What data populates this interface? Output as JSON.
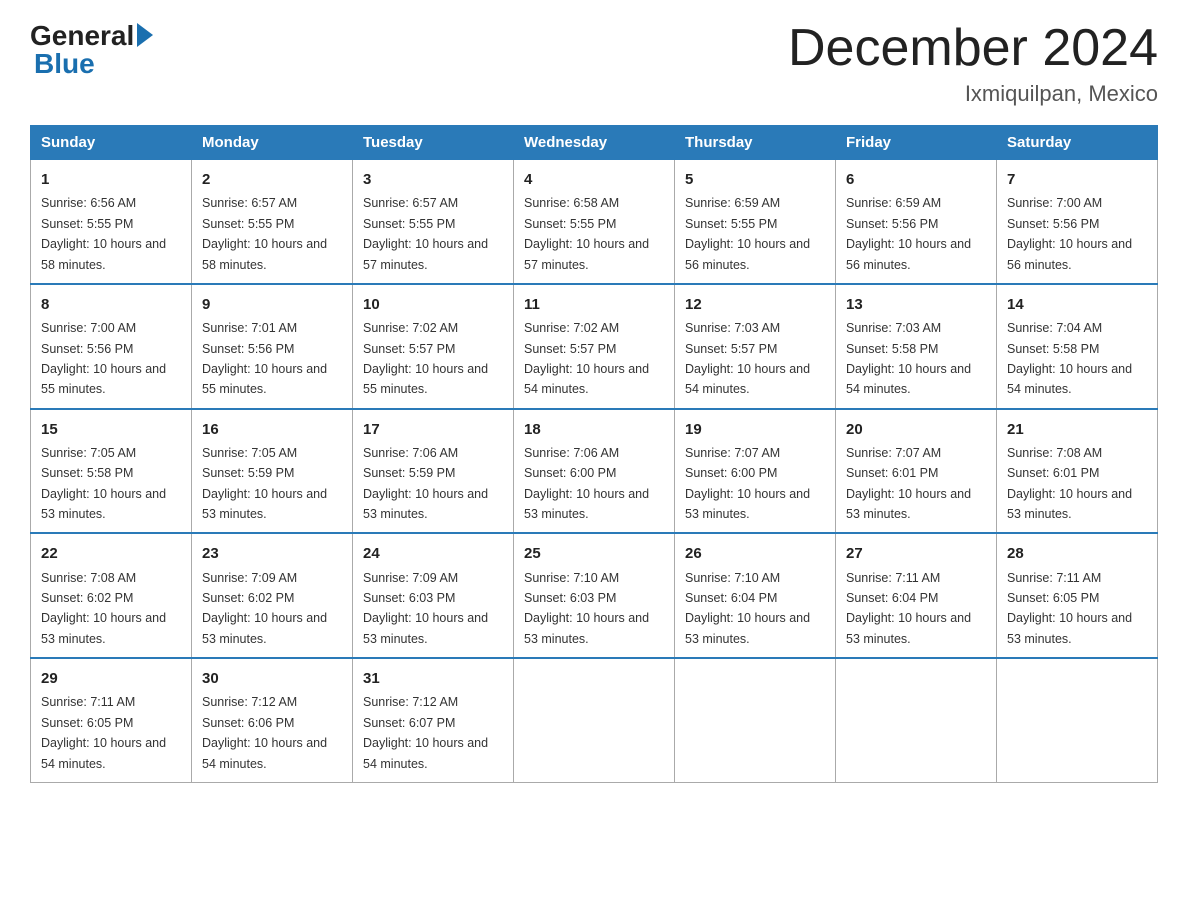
{
  "logo": {
    "general": "General",
    "blue": "Blue"
  },
  "title": "December 2024",
  "location": "Ixmiquilpan, Mexico",
  "headers": [
    "Sunday",
    "Monday",
    "Tuesday",
    "Wednesday",
    "Thursday",
    "Friday",
    "Saturday"
  ],
  "weeks": [
    [
      {
        "day": "1",
        "sunrise": "6:56 AM",
        "sunset": "5:55 PM",
        "daylight": "10 hours and 58 minutes."
      },
      {
        "day": "2",
        "sunrise": "6:57 AM",
        "sunset": "5:55 PM",
        "daylight": "10 hours and 58 minutes."
      },
      {
        "day": "3",
        "sunrise": "6:57 AM",
        "sunset": "5:55 PM",
        "daylight": "10 hours and 57 minutes."
      },
      {
        "day": "4",
        "sunrise": "6:58 AM",
        "sunset": "5:55 PM",
        "daylight": "10 hours and 57 minutes."
      },
      {
        "day": "5",
        "sunrise": "6:59 AM",
        "sunset": "5:55 PM",
        "daylight": "10 hours and 56 minutes."
      },
      {
        "day": "6",
        "sunrise": "6:59 AM",
        "sunset": "5:56 PM",
        "daylight": "10 hours and 56 minutes."
      },
      {
        "day": "7",
        "sunrise": "7:00 AM",
        "sunset": "5:56 PM",
        "daylight": "10 hours and 56 minutes."
      }
    ],
    [
      {
        "day": "8",
        "sunrise": "7:00 AM",
        "sunset": "5:56 PM",
        "daylight": "10 hours and 55 minutes."
      },
      {
        "day": "9",
        "sunrise": "7:01 AM",
        "sunset": "5:56 PM",
        "daylight": "10 hours and 55 minutes."
      },
      {
        "day": "10",
        "sunrise": "7:02 AM",
        "sunset": "5:57 PM",
        "daylight": "10 hours and 55 minutes."
      },
      {
        "day": "11",
        "sunrise": "7:02 AM",
        "sunset": "5:57 PM",
        "daylight": "10 hours and 54 minutes."
      },
      {
        "day": "12",
        "sunrise": "7:03 AM",
        "sunset": "5:57 PM",
        "daylight": "10 hours and 54 minutes."
      },
      {
        "day": "13",
        "sunrise": "7:03 AM",
        "sunset": "5:58 PM",
        "daylight": "10 hours and 54 minutes."
      },
      {
        "day": "14",
        "sunrise": "7:04 AM",
        "sunset": "5:58 PM",
        "daylight": "10 hours and 54 minutes."
      }
    ],
    [
      {
        "day": "15",
        "sunrise": "7:05 AM",
        "sunset": "5:58 PM",
        "daylight": "10 hours and 53 minutes."
      },
      {
        "day": "16",
        "sunrise": "7:05 AM",
        "sunset": "5:59 PM",
        "daylight": "10 hours and 53 minutes."
      },
      {
        "day": "17",
        "sunrise": "7:06 AM",
        "sunset": "5:59 PM",
        "daylight": "10 hours and 53 minutes."
      },
      {
        "day": "18",
        "sunrise": "7:06 AM",
        "sunset": "6:00 PM",
        "daylight": "10 hours and 53 minutes."
      },
      {
        "day": "19",
        "sunrise": "7:07 AM",
        "sunset": "6:00 PM",
        "daylight": "10 hours and 53 minutes."
      },
      {
        "day": "20",
        "sunrise": "7:07 AM",
        "sunset": "6:01 PM",
        "daylight": "10 hours and 53 minutes."
      },
      {
        "day": "21",
        "sunrise": "7:08 AM",
        "sunset": "6:01 PM",
        "daylight": "10 hours and 53 minutes."
      }
    ],
    [
      {
        "day": "22",
        "sunrise": "7:08 AM",
        "sunset": "6:02 PM",
        "daylight": "10 hours and 53 minutes."
      },
      {
        "day": "23",
        "sunrise": "7:09 AM",
        "sunset": "6:02 PM",
        "daylight": "10 hours and 53 minutes."
      },
      {
        "day": "24",
        "sunrise": "7:09 AM",
        "sunset": "6:03 PM",
        "daylight": "10 hours and 53 minutes."
      },
      {
        "day": "25",
        "sunrise": "7:10 AM",
        "sunset": "6:03 PM",
        "daylight": "10 hours and 53 minutes."
      },
      {
        "day": "26",
        "sunrise": "7:10 AM",
        "sunset": "6:04 PM",
        "daylight": "10 hours and 53 minutes."
      },
      {
        "day": "27",
        "sunrise": "7:11 AM",
        "sunset": "6:04 PM",
        "daylight": "10 hours and 53 minutes."
      },
      {
        "day": "28",
        "sunrise": "7:11 AM",
        "sunset": "6:05 PM",
        "daylight": "10 hours and 53 minutes."
      }
    ],
    [
      {
        "day": "29",
        "sunrise": "7:11 AM",
        "sunset": "6:05 PM",
        "daylight": "10 hours and 54 minutes."
      },
      {
        "day": "30",
        "sunrise": "7:12 AM",
        "sunset": "6:06 PM",
        "daylight": "10 hours and 54 minutes."
      },
      {
        "day": "31",
        "sunrise": "7:12 AM",
        "sunset": "6:07 PM",
        "daylight": "10 hours and 54 minutes."
      },
      null,
      null,
      null,
      null
    ]
  ]
}
